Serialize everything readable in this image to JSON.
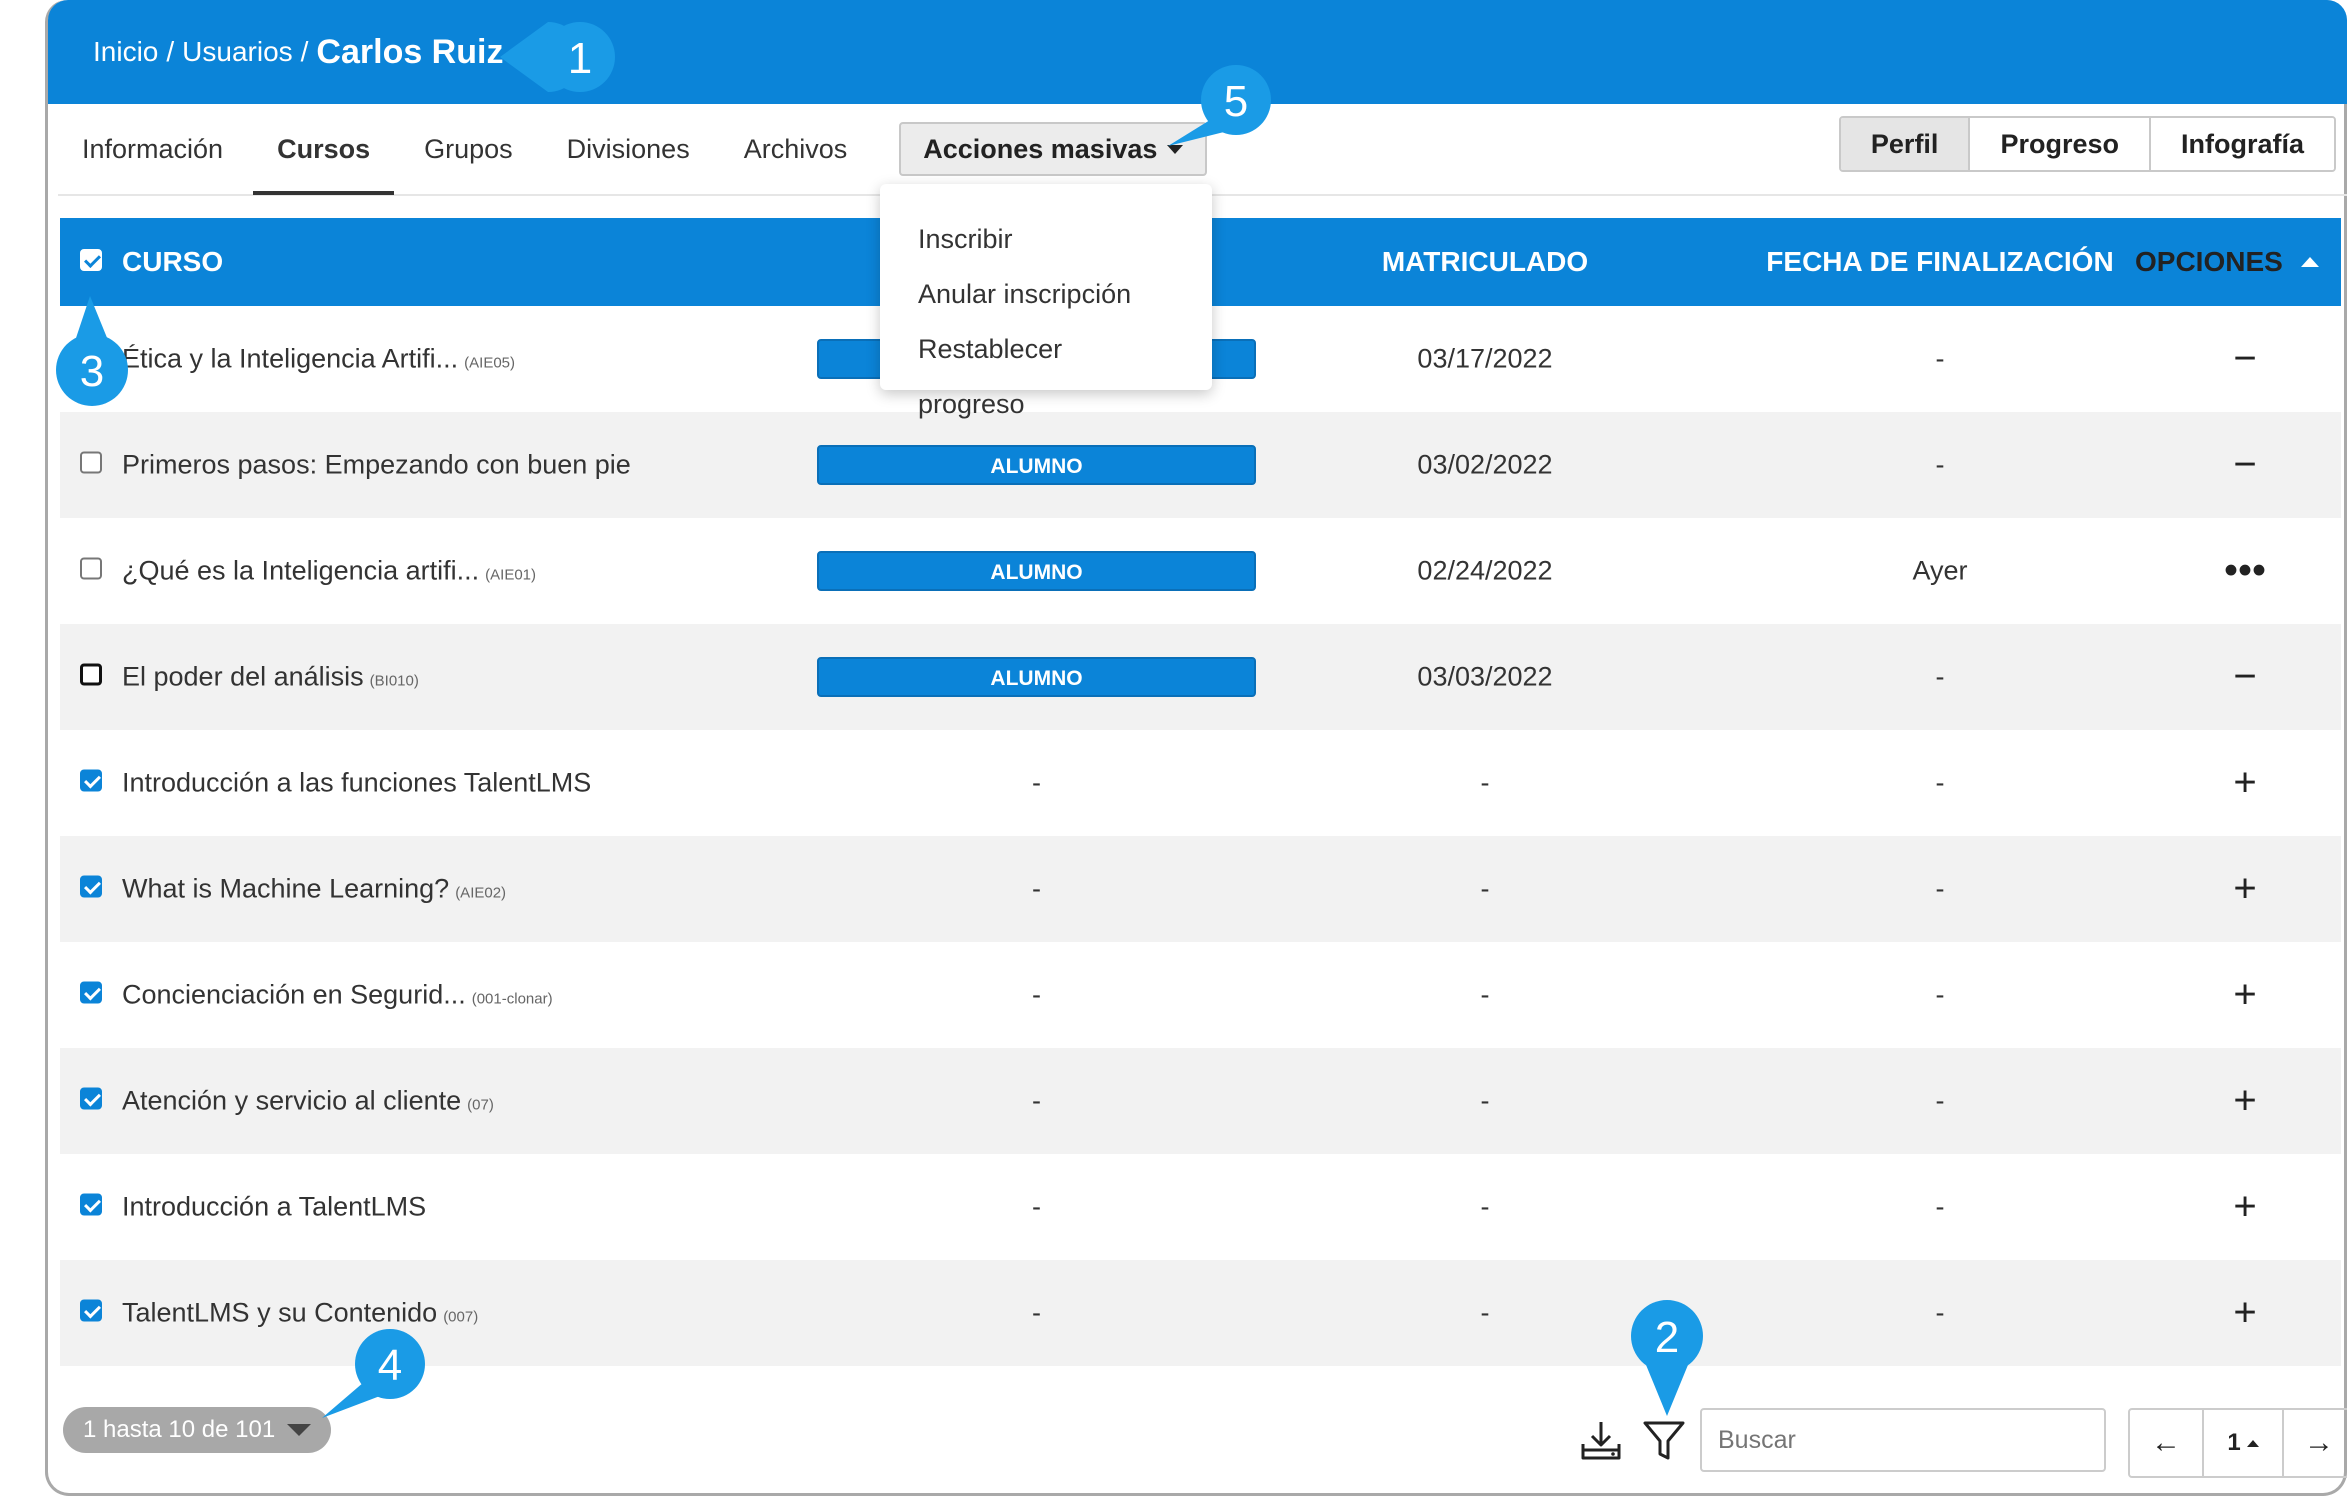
{
  "breadcrumb": {
    "home": "Inicio",
    "section": "Usuarios",
    "current": "Carlos Ruiz",
    "separator": "/"
  },
  "tabs": [
    {
      "label": "Información",
      "active": false
    },
    {
      "label": "Cursos",
      "active": true
    },
    {
      "label": "Grupos",
      "active": false
    },
    {
      "label": "Divisiones",
      "active": false
    },
    {
      "label": "Archivos",
      "active": false
    }
  ],
  "mass_actions": {
    "label": "Acciones masivas",
    "items": [
      "Inscribir",
      "Anular inscripción",
      "Restablecer progreso"
    ]
  },
  "view_toggle": [
    "Perfil",
    "Progreso",
    "Infografía"
  ],
  "table": {
    "headers": {
      "course": "CURSO",
      "enrolled": "MATRICULADO",
      "completion": "FECHA DE FINALIZACIÓN",
      "options": "OPCIONES"
    },
    "rows": [
      {
        "name": "Ética y la Inteligencia Artifi...",
        "code": "(AIE05)",
        "role": "ALUMNO",
        "enrolled": "03/17/2022",
        "completion": "-",
        "option": "−",
        "checked": false
      },
      {
        "name": "Primeros pasos: Empezando con buen pie",
        "code": "",
        "role": "ALUMNO",
        "enrolled": "03/02/2022",
        "completion": "-",
        "option": "−",
        "checked": false
      },
      {
        "name": "¿Qué es la Inteligencia artifi...",
        "code": "(AIE01)",
        "role": "ALUMNO",
        "enrolled": "02/24/2022",
        "completion": "Ayer",
        "option": "•••",
        "checked": false
      },
      {
        "name": "El poder del análisis",
        "code": "(BI010)",
        "role": "ALUMNO",
        "enrolled": "03/03/2022",
        "completion": "-",
        "option": "−",
        "checked": false
      },
      {
        "name": "Introducción a las funciones TalentLMS",
        "code": "",
        "role": "-",
        "enrolled": "-",
        "completion": "-",
        "option": "+",
        "checked": true
      },
      {
        "name": "What is Machine Learning?",
        "code": "(AIE02)",
        "role": "-",
        "enrolled": "-",
        "completion": "-",
        "option": "+",
        "checked": true
      },
      {
        "name": "Concienciación en Segurid...",
        "code": "(001-clonar)",
        "role": "-",
        "enrolled": "-",
        "completion": "-",
        "option": "+",
        "checked": true
      },
      {
        "name": "Atención y servicio al cliente",
        "code": "(07)",
        "role": "-",
        "enrolled": "-",
        "completion": "-",
        "option": "+",
        "checked": true
      },
      {
        "name": "Introducción a TalentLMS",
        "code": "",
        "role": "-",
        "enrolled": "-",
        "completion": "-",
        "option": "+",
        "checked": true
      },
      {
        "name": "TalentLMS y su Contenido",
        "code": "(007)",
        "role": "-",
        "enrolled": "-",
        "completion": "-",
        "option": "+",
        "checked": true
      }
    ]
  },
  "footer": {
    "count": "1 hasta 10 de 101",
    "search_placeholder": "Buscar",
    "prev": "←",
    "page": "1",
    "next": "→"
  },
  "callouts": [
    "1",
    "2",
    "3",
    "4",
    "5"
  ],
  "colors": {
    "primary": "#0b84d8",
    "callout": "#1a9be6"
  }
}
